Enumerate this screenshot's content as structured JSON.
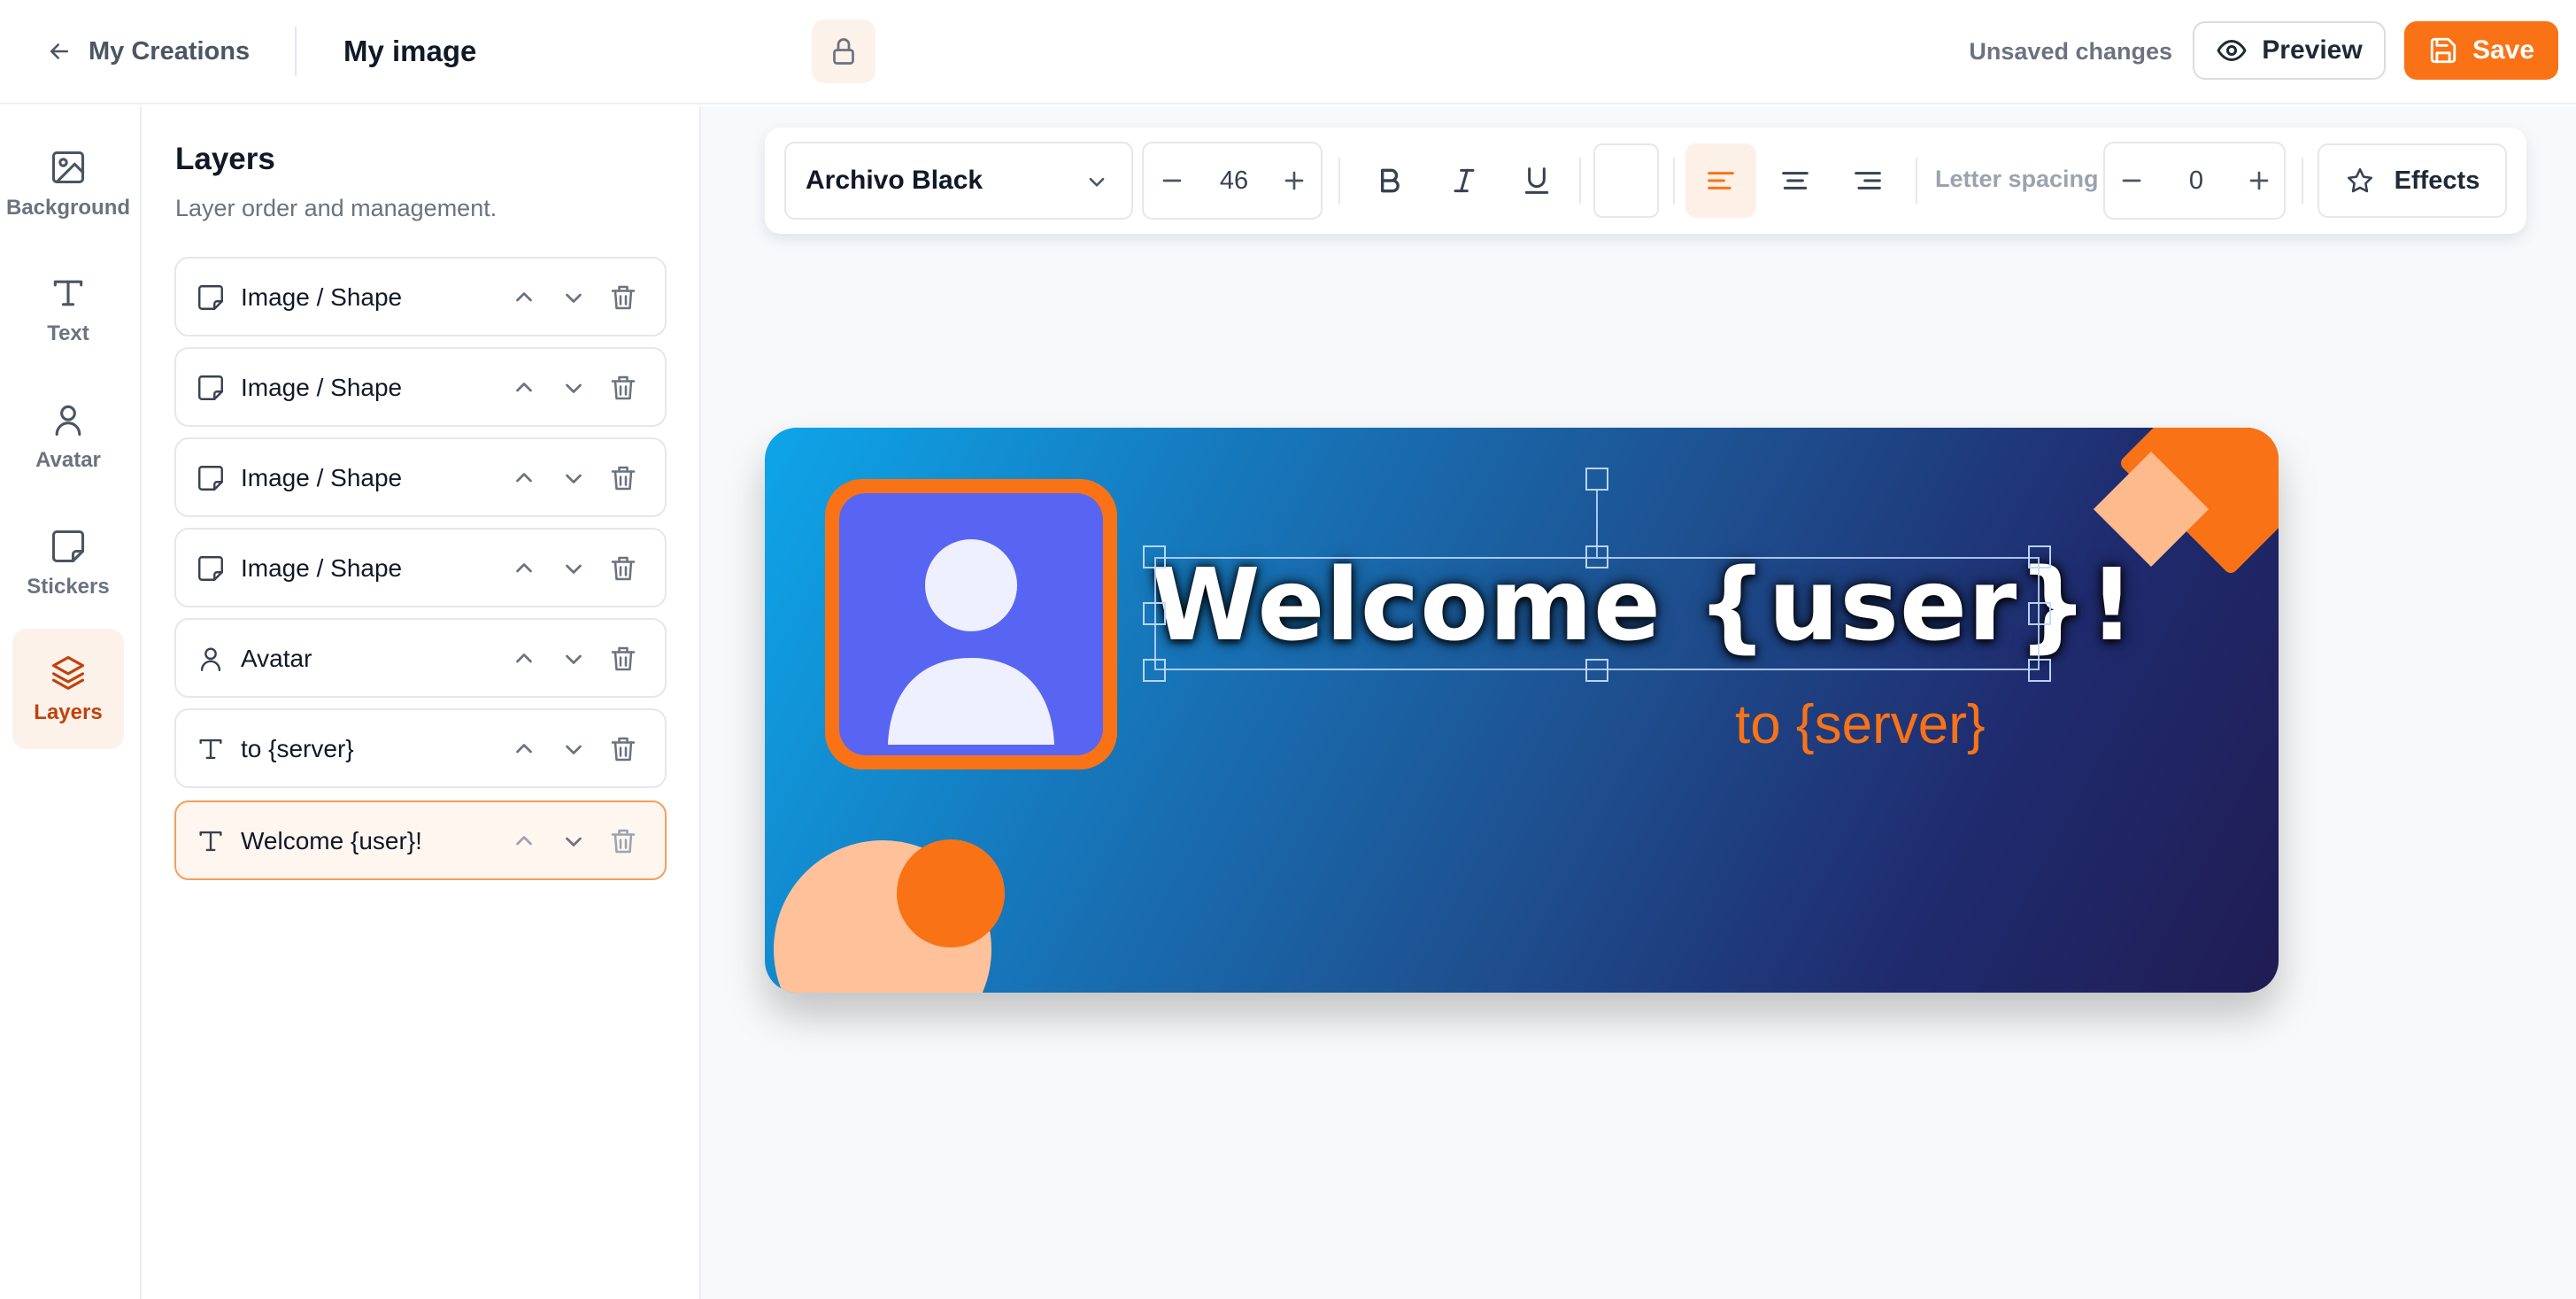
{
  "header": {
    "back_label": "My Creations",
    "title": "My image",
    "unsaved_label": "Unsaved changes",
    "preview_label": "Preview",
    "save_label": "Save"
  },
  "rail": {
    "items": [
      {
        "label": "Background",
        "icon": "image-icon"
      },
      {
        "label": "Text",
        "icon": "text-icon"
      },
      {
        "label": "Avatar",
        "icon": "user-icon"
      },
      {
        "label": "Stickers",
        "icon": "sticker-icon"
      },
      {
        "label": "Layers",
        "icon": "layers-icon",
        "active": true
      }
    ]
  },
  "layers_panel": {
    "title": "Layers",
    "subtitle": "Layer order and management.",
    "items": [
      {
        "label": "Image / Shape",
        "icon": "sticker-icon"
      },
      {
        "label": "Image / Shape",
        "icon": "sticker-icon"
      },
      {
        "label": "Image / Shape",
        "icon": "sticker-icon"
      },
      {
        "label": "Image / Shape",
        "icon": "sticker-icon"
      },
      {
        "label": "Avatar",
        "icon": "user-icon"
      },
      {
        "label": "to {server}",
        "icon": "text-icon"
      },
      {
        "label": "Welcome {user}!",
        "icon": "text-icon",
        "selected": true
      }
    ]
  },
  "toolbar": {
    "font_family": "Archivo Black",
    "font_size": "46",
    "letter_spacing_label": "Letter spacing",
    "letter_spacing": "0",
    "text_color": "#ffffff",
    "alignment": "left",
    "effects_label": "Effects"
  },
  "canvas": {
    "headline": "Welcome {user}!",
    "subline": "to {server}",
    "colors": {
      "accent": "#f97316",
      "avatar_bg": "#5865f2",
      "gradient_start": "#0ea5e9",
      "gradient_end": "#201c53",
      "peach": "#fec19a"
    }
  }
}
